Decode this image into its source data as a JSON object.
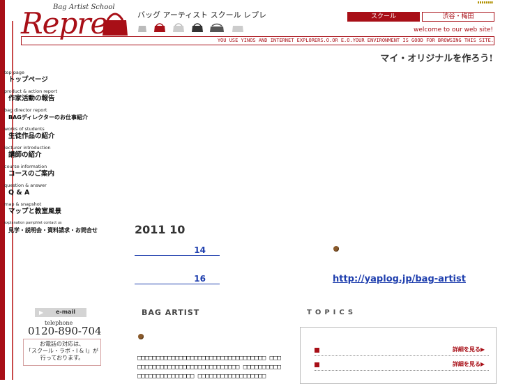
{
  "header": {
    "logo_school": "Bag Artist School",
    "logo_main": "Repre",
    "school_name_jp": "バッグ アーティスト スクール レプレ",
    "school_button": "スクール",
    "location_button": "渋谷・梅田",
    "welcome": "welcome to our web site!",
    "banner": "YOU USE YINOS AND INTERNET EXPLORERS.O.OR E.O.YOUR ENVIRONMENT IS GOOD FOR BROWSING THIS SITE.",
    "tagline": "マイ・オリジナルを作ろう!"
  },
  "nav": [
    {
      "en": "top page",
      "jp": "トップページ"
    },
    {
      "en": "product & action report",
      "jp": "作家活動の報告"
    },
    {
      "en": "bag director report",
      "jp": "BAGディレクターのお仕事紹介"
    },
    {
      "en": "works of students",
      "jp": "生徒作品の紹介"
    },
    {
      "en": "lecturer introduction",
      "jp": "講師の紹介"
    },
    {
      "en": "course information",
      "jp": "コースのご案内"
    },
    {
      "en": "question & answer",
      "jp": "Q & A"
    },
    {
      "en": "map & snapshot",
      "jp": "マップと教室風景"
    },
    {
      "en": "explanation pamphlet contact us",
      "jp": "見学・説明会・資料請求・お問合せ"
    }
  ],
  "main": {
    "date": "2011  10",
    "entry_1": "14",
    "entry_2": "16",
    "blog_url": "http://yaplog.jp/bag-artist"
  },
  "contact": {
    "email_label": "e-mail",
    "telephone_label": "telephone",
    "telephone": "0120-890-704",
    "note_line1": "お電話の対応は、",
    "note_line2": "「スクール・ラボ・I & I」が",
    "note_line3": "行っております。"
  },
  "sections": {
    "bag_artist": "BAG ARTIST",
    "bag_artist_text": "□□□□□□□□□□□□□□□□□□□□□□□□□□□□□□□□□□ □□□ □□□□□□□□□□□□□□□□□□□□□□□□□□□ □□□□□□□□□□ □□□□□□□□□□□□□□□ □□□□□□□□□□□□□□□□□□",
    "topics": "TOPICS",
    "topics_more_1": "詳細を見る▶",
    "topics_more_2": "詳細を見る▶"
  },
  "colors": {
    "brand": "#a80f17",
    "link": "#1f3fae"
  }
}
